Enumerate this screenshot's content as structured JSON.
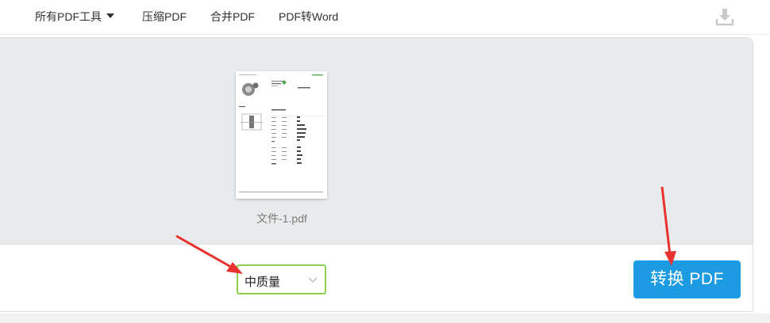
{
  "nav": {
    "all_tools": "所有PDF工具",
    "compress": "压缩PDF",
    "merge": "合并PDF",
    "to_word": "PDF转Word"
  },
  "icons": {
    "download": "download-icon",
    "caret": "caret-down-icon",
    "chevron": "chevron-down-icon"
  },
  "file": {
    "name": "文件-1.pdf"
  },
  "quality": {
    "selected": "中质量"
  },
  "convert": {
    "label": "转换 PDF"
  },
  "colors": {
    "accent": "#1c9be3",
    "select_border": "#8fd14f",
    "workspace_bg": "#e9eaeb",
    "annotation_arrow": "#e8322f"
  }
}
